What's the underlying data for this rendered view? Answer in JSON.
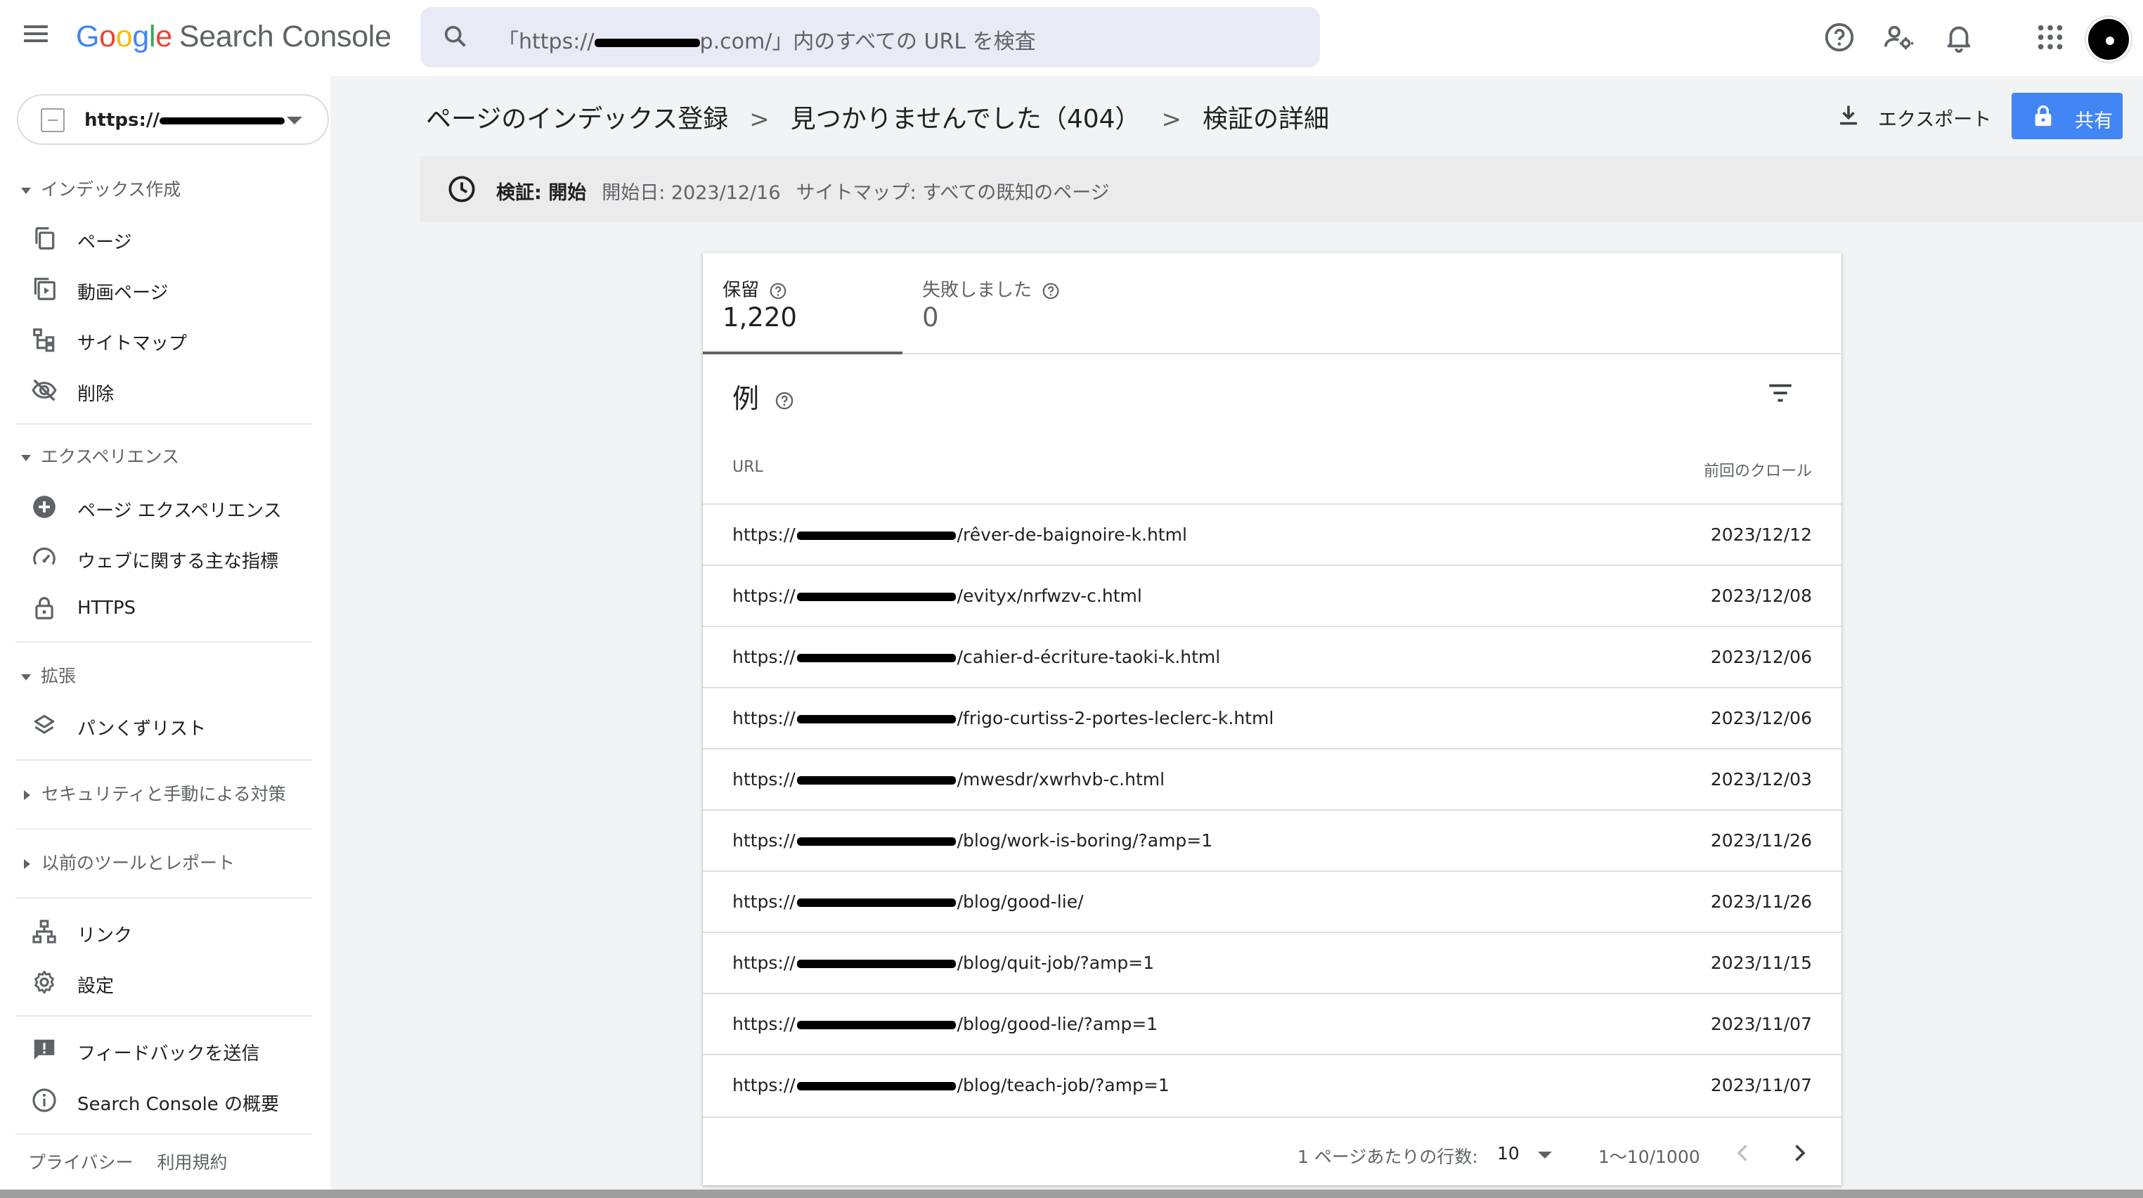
{
  "app": {
    "logo_letters": [
      "G",
      "o",
      "o",
      "g",
      "l",
      "e"
    ],
    "product": "Search Console",
    "search_placeholder": "「https://",
    "search_placeholder_tail": "p.com/」内のすべての URL を検査"
  },
  "topbar_icons": [
    "help-icon",
    "manage-users-icon",
    "notifications-icon",
    "apps-grid-icon",
    "account-avatar"
  ],
  "property": {
    "prefix": "https://"
  },
  "sidebar": {
    "sections": [
      {
        "label": "インデックス作成",
        "expanded": true,
        "items": [
          "ページ",
          "動画ページ",
          "サイトマップ",
          "削除"
        ]
      },
      {
        "label": "エクスペリエンス",
        "expanded": true,
        "items": [
          "ページ エクスペリエンス",
          "ウェブに関する主な指標",
          "HTTPS"
        ]
      },
      {
        "label": "拡張",
        "expanded": true,
        "items": [
          "パンくずリスト"
        ]
      },
      {
        "label": "セキュリティと手動による対策",
        "expanded": false,
        "items": []
      },
      {
        "label": "以前のツールとレポート",
        "expanded": false,
        "items": []
      }
    ],
    "tools": [
      "リンク",
      "設定"
    ],
    "support": [
      "フィードバックを送信",
      "Search Console の概要"
    ],
    "footer": [
      "プライバシー",
      "利用規約"
    ]
  },
  "breadcrumb": [
    "ページのインデックス登録",
    "見つかりませんでした（404）",
    "検証の詳細"
  ],
  "actions": {
    "export": "エクスポート",
    "share": "共有"
  },
  "validation": {
    "status_label": "検証: 開始",
    "start_date": "開始日: 2023/12/16",
    "sitemap": "サイトマップ: すべての既知のページ"
  },
  "tabs": [
    {
      "label": "保留",
      "value": "1,220",
      "active": true
    },
    {
      "label": "失敗しました",
      "value": "0",
      "active": false
    }
  ],
  "examples": {
    "title": "例",
    "columns": {
      "url": "URL",
      "last_crawl": "前回のクロール"
    },
    "rows": [
      {
        "url_prefix": "https://",
        "url_path": "/rêver-de-baignoire-k.html",
        "date": "2023/12/12"
      },
      {
        "url_prefix": "https://",
        "url_path": "/evityx/nrfwzv-c.html",
        "date": "2023/12/08"
      },
      {
        "url_prefix": "https://",
        "url_path": "/cahier-d-écriture-taoki-k.html",
        "date": "2023/12/06"
      },
      {
        "url_prefix": "https://",
        "url_path": "/frigo-curtiss-2-portes-leclerc-k.html",
        "date": "2023/12/06"
      },
      {
        "url_prefix": "https://",
        "url_path": "/mwesdr/xwrhvb-c.html",
        "date": "2023/12/03"
      },
      {
        "url_prefix": "https://",
        "url_path": "/blog/work-is-boring/?amp=1",
        "date": "2023/11/26"
      },
      {
        "url_prefix": "https://",
        "url_path": "/blog/good-lie/",
        "date": "2023/11/26"
      },
      {
        "url_prefix": "https://",
        "url_path": "/blog/quit-job/?amp=1",
        "date": "2023/11/15"
      },
      {
        "url_prefix": "https://",
        "url_path": "/blog/good-lie/?amp=1",
        "date": "2023/11/07"
      },
      {
        "url_prefix": "https://",
        "url_path": "/blog/teach-job/?amp=1",
        "date": "2023/11/07"
      }
    ]
  },
  "pagination": {
    "rows_per_page_label": "1 ページあたりの行数:",
    "rows_per_page": "10",
    "range": "1〜10/1000"
  },
  "colors": {
    "accent_blue": "#4285f4",
    "text": "#202124",
    "muted": "#5f6368"
  }
}
